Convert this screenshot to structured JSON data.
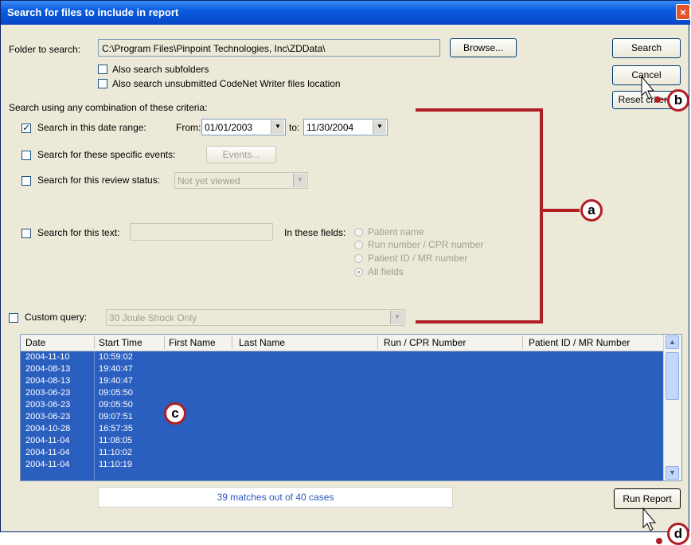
{
  "window": {
    "title": "Search for files to include in report",
    "close": "×"
  },
  "folder": {
    "label": "Folder to search:",
    "path": "C:\\Program Files\\Pinpoint Technologies, Inc\\ZDData\\",
    "browse": "Browse..."
  },
  "options": {
    "subfolders": "Also search subfolders",
    "unsubmitted": "Also search unsubmitted CodeNet Writer files location"
  },
  "buttons": {
    "search": "Search",
    "cancel": "Cancel",
    "reset": "Reset criteria",
    "run_report": "Run Report"
  },
  "criteria": {
    "heading": "Search using any combination of these criteria:",
    "date_range": {
      "label": "Search in this date range:",
      "checked": "✓",
      "from_label": "From:",
      "from": "01/01/2003",
      "to_label": "to:",
      "to": "11/30/2004"
    },
    "events": {
      "label": "Search for these specific events:",
      "button": "Events..."
    },
    "review": {
      "label": "Search for this review status:",
      "value": "Not yet viewed"
    },
    "text": {
      "label": "Search for this text:",
      "fields_label": "In these fields:",
      "fields": [
        "Patient name",
        "Run number / CPR number",
        "Patient ID / MR number",
        "All fields"
      ]
    },
    "custom": {
      "label": "Custom query:",
      "value": "30 Joule Shock Only"
    }
  },
  "table": {
    "columns": [
      "Date",
      "Start Time",
      "First Name",
      "Last Name",
      "Run / CPR Number",
      "Patient ID / MR Number"
    ],
    "rows": [
      [
        "2004-11-10",
        "10:59:02"
      ],
      [
        "2004-08-13",
        "19:40:47"
      ],
      [
        "2004-08-13",
        "19:40:47"
      ],
      [
        "2003-06-23",
        "09:05:50"
      ],
      [
        "2003-06-23",
        "09:05:50"
      ],
      [
        "2003-06-23",
        "09:07:51"
      ],
      [
        "2004-10-28",
        "16:57:35"
      ],
      [
        "2004-11-04",
        "11:08:05"
      ],
      [
        "2004-11-04",
        "11:10:02"
      ],
      [
        "2004-11-04",
        "11:10:19"
      ]
    ]
  },
  "status": "39 matches out of 40 cases",
  "callouts": {
    "a": "a",
    "b": "b",
    "c": "c",
    "d": "d"
  },
  "colors": {
    "title_bar": "#0a5ce0",
    "selection": "#2b5fbf",
    "callout_red": "#b01e24",
    "status_text": "#2d57c4"
  }
}
